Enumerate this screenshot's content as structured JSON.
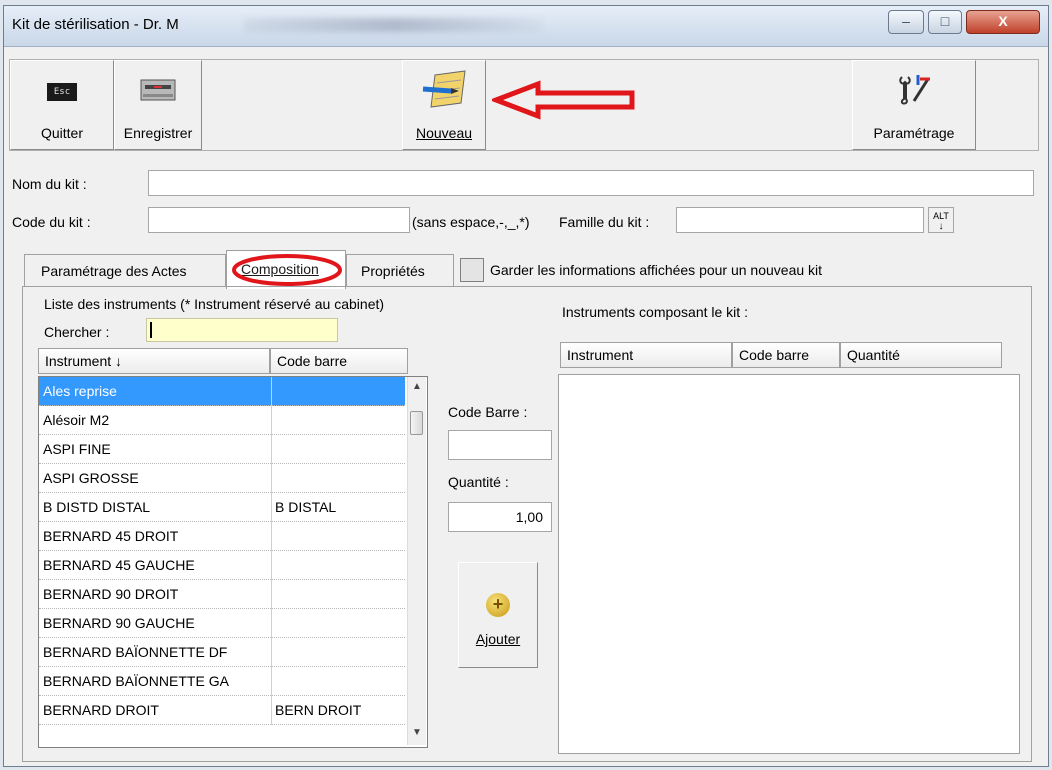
{
  "window": {
    "title": "Kit de stérilisation - Dr. M",
    "minimize": "–",
    "maximize": "□",
    "close": "X"
  },
  "toolbar": {
    "quit_label": "Quitter",
    "quit_icon_text": "Esc",
    "save_label": "Enregistrer",
    "new_label": "Nouveau",
    "settings_label": "Paramétrage"
  },
  "form": {
    "kit_name_label": "Nom du kit :",
    "kit_name_value": "",
    "kit_code_label": "Code du kit :",
    "kit_code_value": "",
    "kit_code_hint": "(sans espace,-,_,*)",
    "family_label": "Famille du kit :",
    "family_value": "",
    "family_btn": "ALT"
  },
  "tabs": {
    "acts": "Paramétrage des Actes",
    "composition": "Composition",
    "properties": "Propriétés",
    "keep_label": "Garder les informations affichées pour un nouveau kit"
  },
  "left": {
    "list_title": "Liste des instruments (* Instrument réservé au cabinet)",
    "search_label": "Chercher :",
    "search_value": "",
    "col_instrument": "Instrument ↓",
    "col_barcode": "Code barre",
    "rows": [
      {
        "instrument": "Ales reprise",
        "barcode": ""
      },
      {
        "instrument": "Alésoir M2",
        "barcode": ""
      },
      {
        "instrument": "ASPI FINE",
        "barcode": ""
      },
      {
        "instrument": "ASPI GROSSE",
        "barcode": ""
      },
      {
        "instrument": "B DISTD DISTAL",
        "barcode": "B DISTAL"
      },
      {
        "instrument": "BERNARD 45 DROIT",
        "barcode": ""
      },
      {
        "instrument": "BERNARD 45 GAUCHE",
        "barcode": ""
      },
      {
        "instrument": "BERNARD 90 DROIT",
        "barcode": ""
      },
      {
        "instrument": "BERNARD 90 GAUCHE",
        "barcode": ""
      },
      {
        "instrument": "BERNARD BAÏONNETTE DF",
        "barcode": ""
      },
      {
        "instrument": "BERNARD BAÏONNETTE GA",
        "barcode": ""
      },
      {
        "instrument": "BERNARD DROIT",
        "barcode": "BERN DROIT"
      }
    ]
  },
  "middle": {
    "barcode_label": "Code Barre :",
    "barcode_value": "",
    "qty_label": "Quantité :",
    "qty_value": "1,00",
    "add_label": "Ajouter"
  },
  "right": {
    "title": "Instruments composant le kit :",
    "col_instrument": "Instrument",
    "col_barcode": "Code barre",
    "col_qty": "Quantité"
  },
  "colors": {
    "selection": "#3399ff",
    "annotation": "#e0161b",
    "search_bg": "#ffffcc"
  }
}
